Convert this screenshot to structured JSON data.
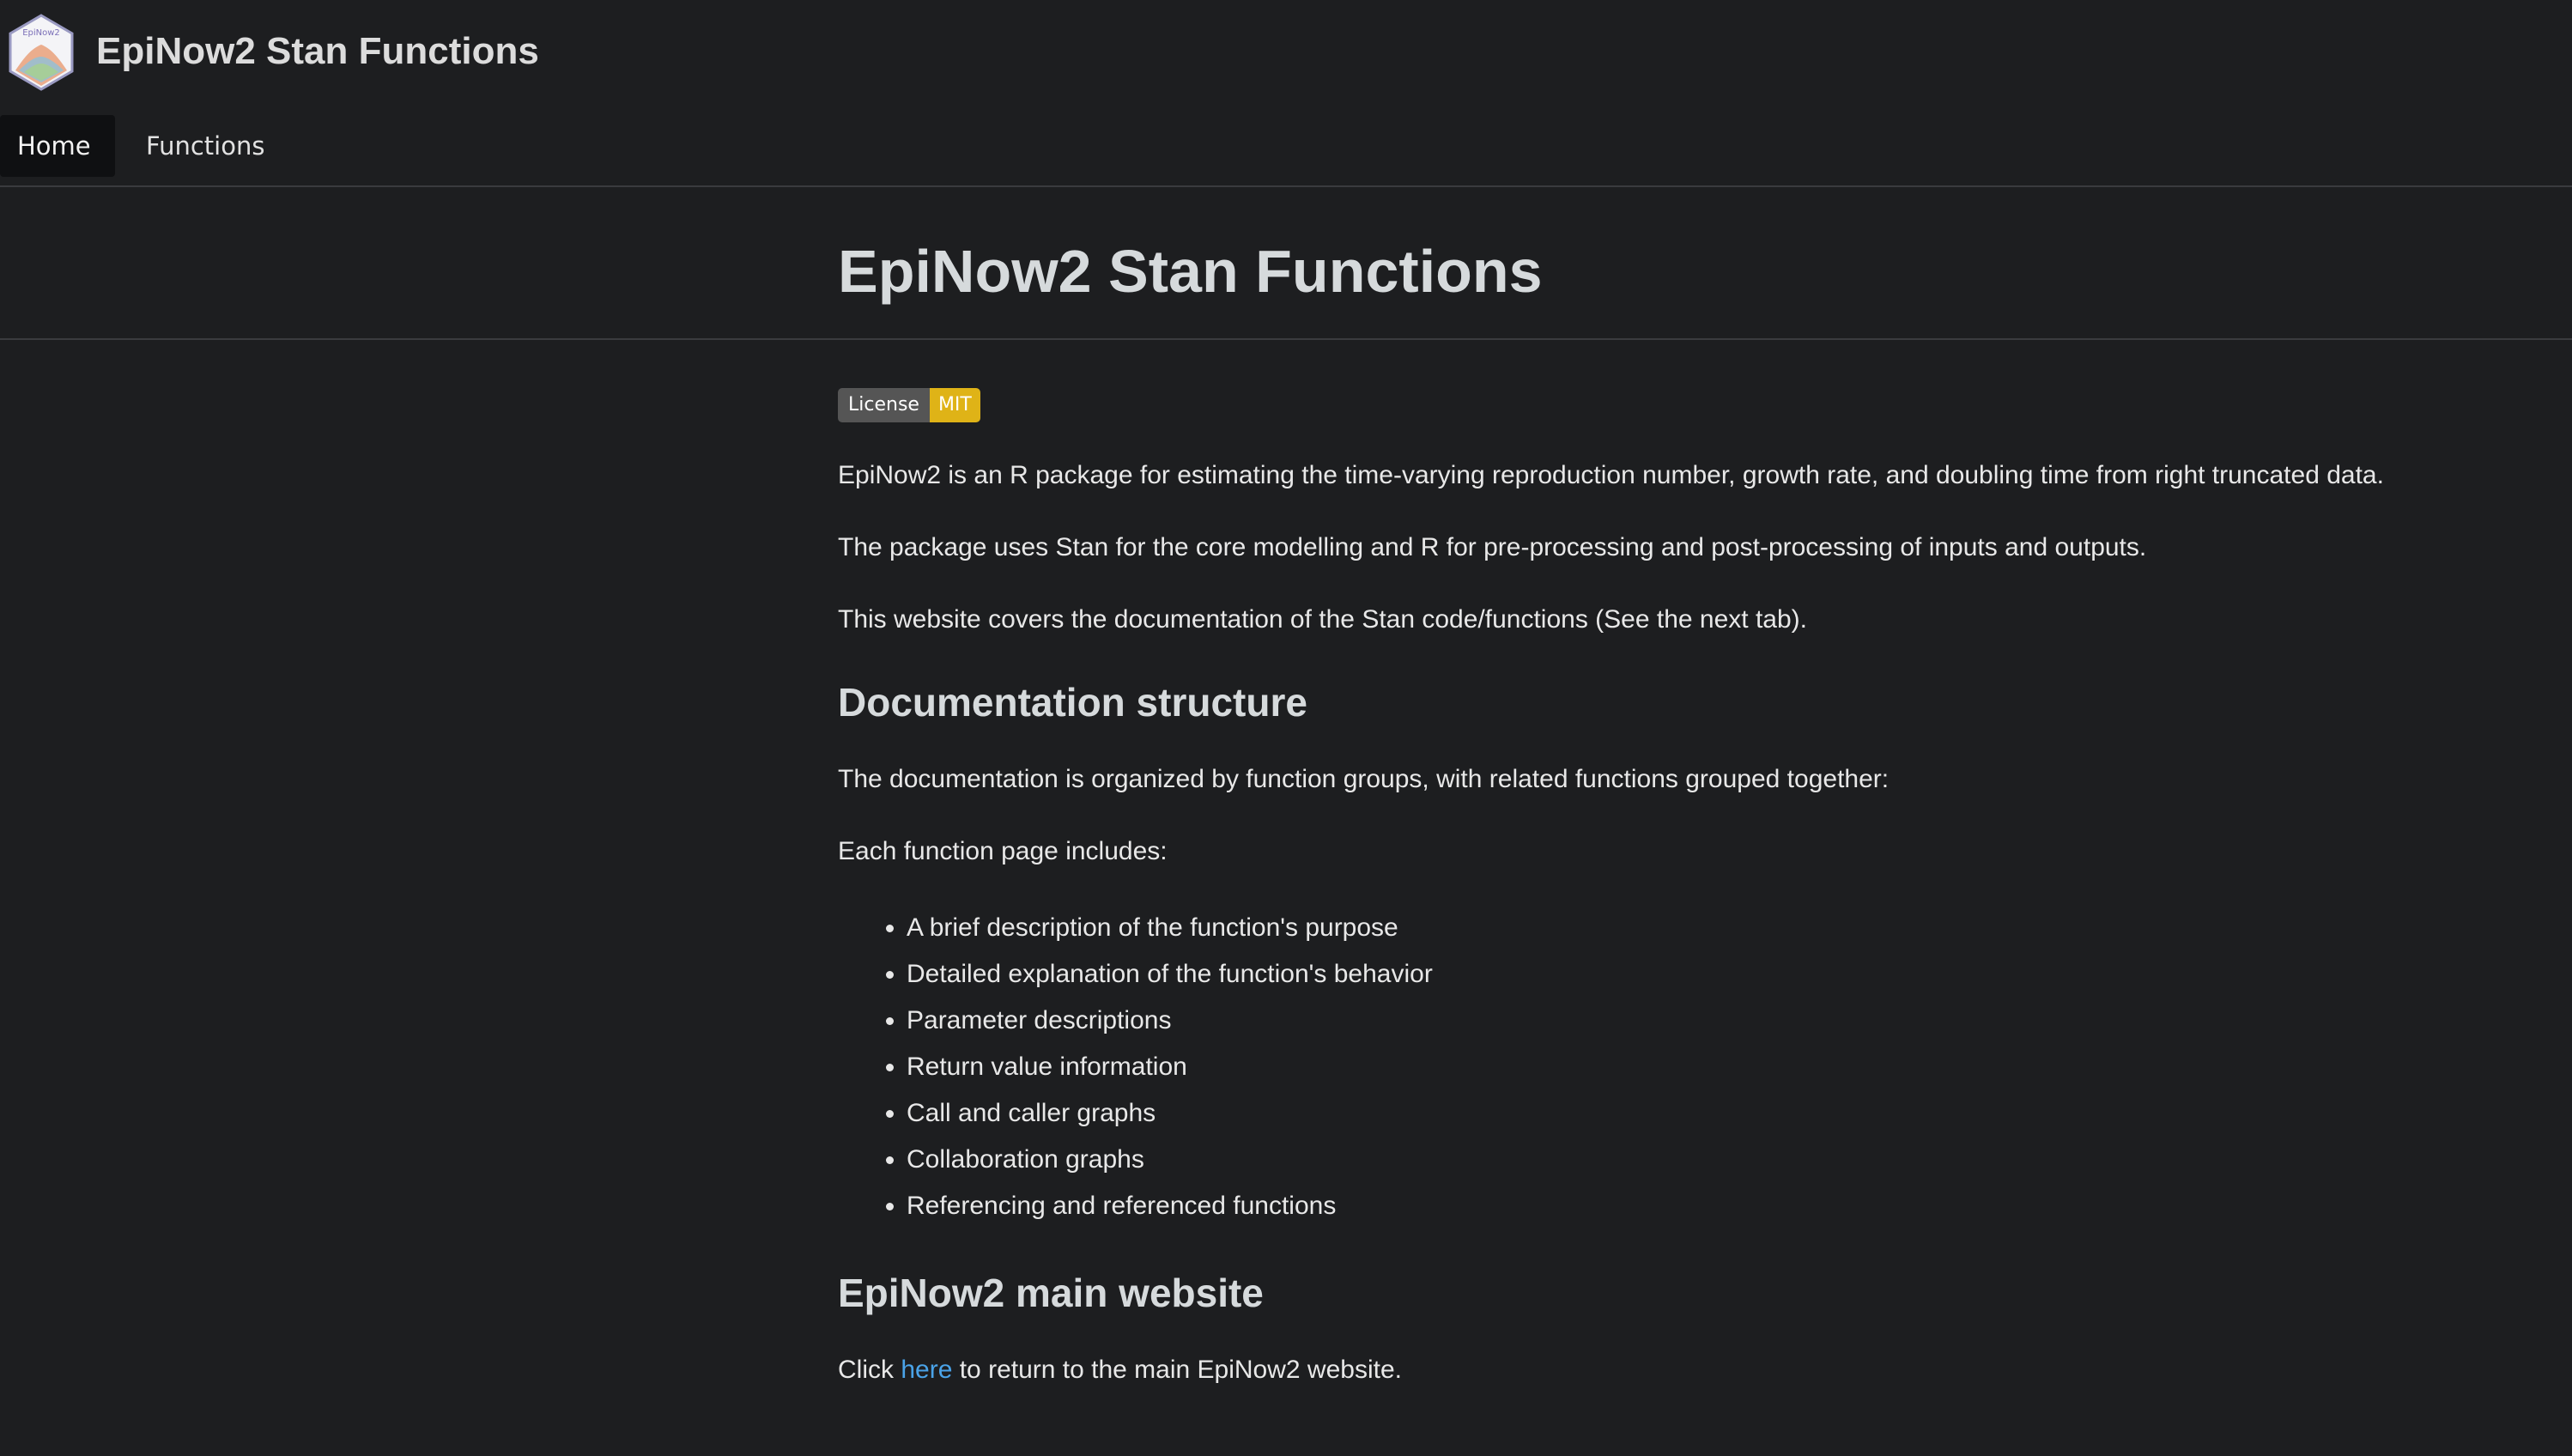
{
  "header": {
    "logo_text": "EpiNow2",
    "project_name": "EpiNow2 Stan Functions"
  },
  "nav": {
    "tabs": [
      {
        "label": "Home",
        "active": true
      },
      {
        "label": "Functions",
        "active": false
      }
    ]
  },
  "page": {
    "title": "EpiNow2 Stan Functions",
    "badge": {
      "left": "License",
      "right": "MIT",
      "right_color": "#dfb317"
    },
    "intro": [
      "EpiNow2 is an R package for estimating the time-varying reproduction number, growth rate, and doubling time from right truncated data.",
      "The package uses Stan for the core modelling and R for pre-processing and post-processing of inputs and outputs.",
      "This website covers the documentation of the Stan code/functions (See the next tab)."
    ],
    "doc_structure": {
      "heading": "Documentation structure",
      "text1": "The documentation is organized by function groups, with related functions grouped together:",
      "text2": "Each function page includes:",
      "items": [
        "A brief description of the function's purpose",
        "Detailed explanation of the function's behavior",
        "Parameter descriptions",
        "Return value information",
        "Call and caller graphs",
        "Collaboration graphs",
        "Referencing and referenced functions"
      ]
    },
    "main_site": {
      "heading": "EpiNow2 main website",
      "before_link": "Click ",
      "link_text": "here",
      "after_link": " to return to the main EpiNow2 website.",
      "link_color": "#4aa3e8"
    }
  }
}
